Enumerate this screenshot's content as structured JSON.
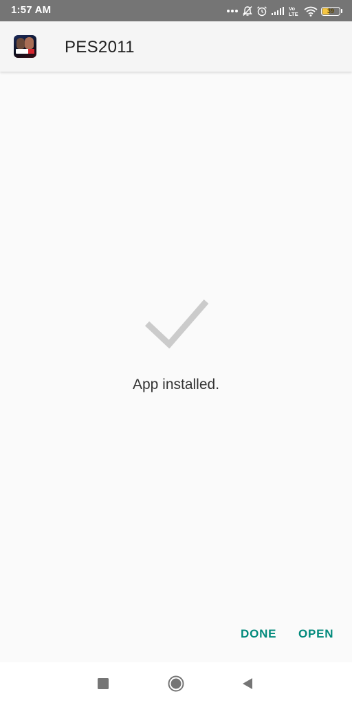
{
  "status_bar": {
    "time": "1:57 AM",
    "dots": "•••",
    "network_label": "Vo LTE",
    "battery_level": "39",
    "battery_fraction": 0.39,
    "icons": [
      "more-dots-icon",
      "notifications-off-icon",
      "alarm-icon",
      "signal-icon",
      "volte-icon",
      "wifi-icon",
      "battery-icon"
    ]
  },
  "header": {
    "app_name": "PES2011",
    "app_icon": "pes2011-app-icon"
  },
  "main": {
    "status_icon": "checkmark-icon",
    "message": "App installed."
  },
  "actions": {
    "done_label": "DONE",
    "open_label": "OPEN",
    "accent_color": "#00897b"
  },
  "navigation": {
    "icons": [
      "recents-icon",
      "home-icon",
      "back-icon"
    ]
  }
}
